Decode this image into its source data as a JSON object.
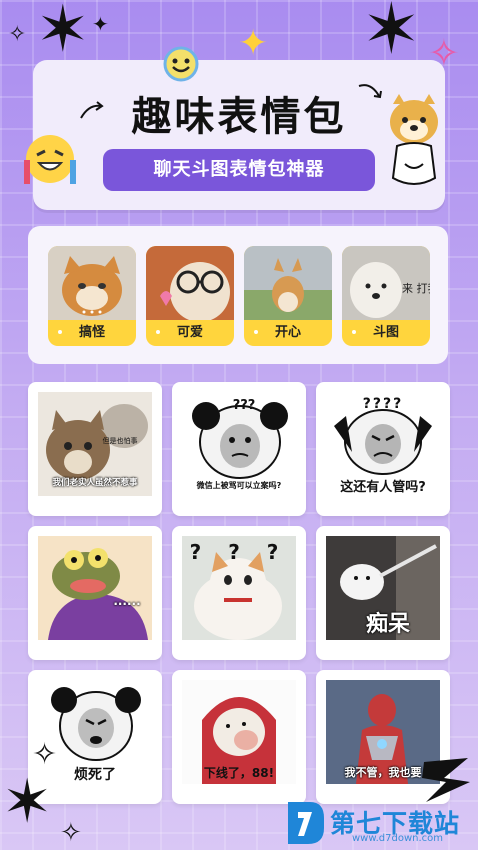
{
  "header": {
    "title": "趣味表情包",
    "subtitle": "聊天斗图表情包神器"
  },
  "categories": [
    {
      "label": "搞怪"
    },
    {
      "label": "可爱"
    },
    {
      "label": "开心"
    },
    {
      "label": "斗图"
    }
  ],
  "memes": [
    {
      "caption": "我们老实人虽然不惹事",
      "caption2": "但是也怕事"
    },
    {
      "caption": "微信上被骂可以立案吗?",
      "caption2": "???"
    },
    {
      "caption": "这还有人管吗?",
      "caption2": "????"
    },
    {
      "caption": "......"
    },
    {
      "caption": "? ? ?"
    },
    {
      "caption": "痴呆"
    },
    {
      "caption": "烦死了"
    },
    {
      "caption": "下线了，88!"
    },
    {
      "caption": "我不管，我也要"
    }
  ],
  "thumb_overlay": "来 打我",
  "watermark": {
    "brand": "第七下载站",
    "url": "www.d7down.com"
  },
  "colors": {
    "accent": "#7a56da",
    "category_bar": "#ffd53d",
    "brand": "#1f86d8"
  }
}
